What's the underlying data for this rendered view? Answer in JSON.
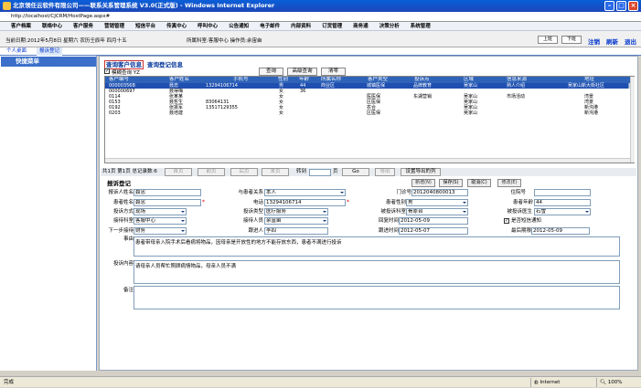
{
  "window": {
    "title": "北京领任云软件有限公司——联系关系管理系统 V3.0(正式版) - Windows Internet Explorer",
    "address": "http://localhost/CJCRM/HostPage.aspx#"
  },
  "menu": {
    "items": [
      "客户档案",
      "联络中心",
      "客户服务",
      "营销管理",
      "短信平台",
      "传真中心",
      "呼叫中心",
      "公告通知",
      "电子邮件",
      "内部资料",
      "订货管理",
      "商务通",
      "决策分析",
      "系统管理"
    ]
  },
  "infobar": {
    "date_text": "当前日期:2012年5月8日 星期六 农历壬辰年 四月十五",
    "dept_text": "所属科室:客服中心 操作员:余宙亩",
    "btn_prev": "上班",
    "btn_next": "下班",
    "link_logout": "注销",
    "link_refresh": "刷新",
    "link_exit": "退出"
  },
  "tabs": [
    "个人桌面",
    "报诉登记"
  ],
  "left": {
    "title": "快捷菜单"
  },
  "section": {
    "tab1": "查询客户信息",
    "tab2": "查询登记信息"
  },
  "query": {
    "checkbox_label": "模糊查询 YZ",
    "checked": "✓",
    "btn_query": "查询",
    "btn_adv": "高级查询",
    "btn_clear": "清零"
  },
  "grid": {
    "headers": [
      "客户编号",
      "客户姓名",
      "手机号",
      "性别",
      "年龄",
      "所属名称",
      "客户类型",
      "投诉点",
      "区域",
      "信息来源",
      "",
      "地址"
    ],
    "rows": [
      [
        "00000356B",
        "聂忠",
        "13294106714",
        "男",
        "44",
        "商业区",
        "城镇医保",
        "品牌教育",
        "吴家山",
        "熟人介绍",
        "",
        "吴家山新大街社区"
      ],
      [
        "000000697",
        "聂得梅",
        "",
        "女",
        "36",
        "",
        "",
        "",
        "",
        "",
        "",
        ""
      ],
      [
        "0114",
        "张某某",
        "",
        "女",
        "",
        "",
        "医医保",
        "东湖营销",
        "吴家山",
        "市场活动",
        "",
        "湾景"
      ],
      [
        "0153",
        "聂哲生",
        "83064131",
        "女",
        "",
        "",
        "区医保",
        "",
        "吴家山",
        "",
        "",
        "湾景"
      ],
      [
        "0192",
        "张振军",
        "13517129355",
        "女",
        "",
        "",
        "农合",
        "",
        "吴家山",
        "",
        "",
        "新沟港"
      ],
      [
        "0203",
        "聂培建",
        "",
        "女",
        "",
        "",
        "区医保",
        "",
        "吴家山",
        "",
        "",
        "新沟港"
      ]
    ]
  },
  "pager": {
    "summary": "共1页 第1页 总记录数:6",
    "first": "首页",
    "prev": "前页",
    "next": "后页",
    "last": "末页",
    "goto_label": "转到",
    "page_unit": "页",
    "go": "Go",
    "export": "导出",
    "export_cols": "设置导出的列"
  },
  "form": {
    "title": "报诉登记",
    "btn_add": "新增(N)",
    "btn_save": "保存(S)",
    "btn_cancel": "取消(C)",
    "btn_edit": "修改(E)",
    "reporter_name_label": "报诉人姓名",
    "reporter_name": "聂忠",
    "relation_label": "与患者关系",
    "relation": "本人",
    "door_no_label": "门诊号",
    "door_no": "2012040800013",
    "hospital_no_label": "住院号",
    "hospital_no": "",
    "patient_name_label": "患者姓名",
    "patient_name": "聂忠",
    "phone_label": "电话",
    "phone": "13294106714",
    "gender_label": "患者性别",
    "gender": "男",
    "age_label": "患者年龄",
    "age": "44",
    "method_label": "投诉方式",
    "method": "现场",
    "type_label": "投诉类型",
    "type": "医疗服务",
    "dept_label": "被投诉科室",
    "dept": "骨原台",
    "target_label": "被投诉医生",
    "target": "石雪",
    "recv_dept_label": "接待科室",
    "recv_dept": "客服中心",
    "recv_person_label": "接待人员",
    "recv_person": "余富亩",
    "visit_time_label": "回复时间",
    "visit_time": "2012-05-09",
    "sms_label": "是否短信通知",
    "next_dept_label": "下一步接待",
    "next_dept": "财务",
    "follow_label": "跟进人",
    "follow": "李四",
    "follow_time_label": "跟进时间",
    "follow_time": "2012-05-07",
    "deadline_label": "最后期限",
    "deadline": "2012-05-09",
    "event_label": "事由",
    "event": "患者带母亲入院手术后看病将物品，因母亲是开放性的地方不能存放东西，患者不满进行投诉",
    "content_label": "投诉内容",
    "content": "请母亲人员帮忙照顾病情物品，母亲人员不满",
    "note_label": "备注",
    "note": ""
  },
  "status": {
    "left": "完成",
    "zone": "Internet",
    "zoom": "100%"
  }
}
